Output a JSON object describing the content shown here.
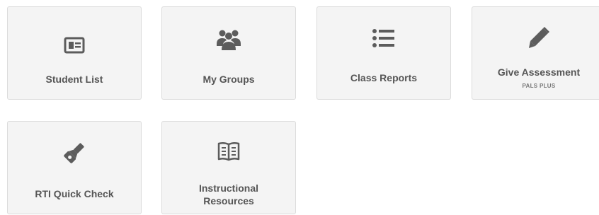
{
  "tiles": [
    {
      "label": "Student List",
      "icon": "id-card-icon"
    },
    {
      "label": "My Groups",
      "icon": "group-icon"
    },
    {
      "label": "Class Reports",
      "icon": "list-icon"
    },
    {
      "label": "Give Assessment",
      "sublabel": "PALS PLUS",
      "icon": "pencil-icon"
    },
    {
      "label": "RTI Quick Check",
      "icon": "flashlight-icon"
    },
    {
      "label": "Instructional Resources",
      "icon": "open-book-icon"
    }
  ],
  "colors": {
    "tile_background": "#f4f4f4",
    "tile_border": "#dcdcdc",
    "icon": "#5c5c5c",
    "label": "#555555"
  }
}
